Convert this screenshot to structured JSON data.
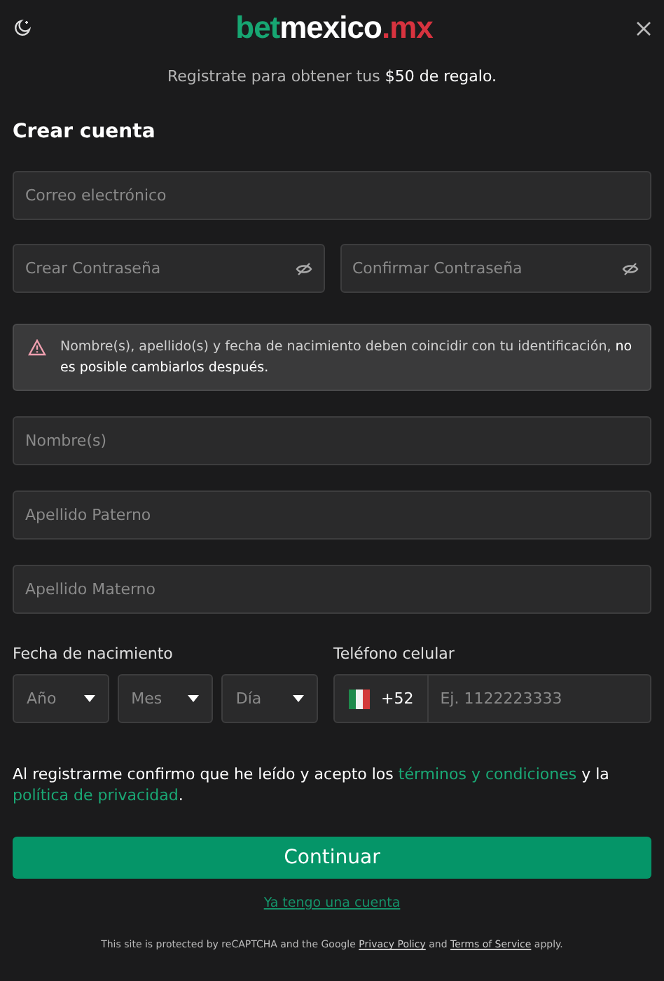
{
  "header": {
    "logo": [
      {
        "text": "bet",
        "color": "#17a672"
      },
      {
        "text": "mexico",
        "color": "#ffffff"
      },
      {
        "text": ".mx",
        "color": "#d8333f"
      }
    ]
  },
  "promo": "Registrate para obtener tus **$50 de regalo.**",
  "title": "Crear cuenta",
  "email": {
    "placeholder": "Correo electrónico"
  },
  "passwords": [
    {
      "placeholder": "Crear Contraseña"
    },
    {
      "placeholder": "Confirmar Contraseña"
    }
  ],
  "notice": "Nombre(s), apellido(s) y fecha de nacimiento deben coincidir con tu identificación, **no es posible cambiarlos después.**",
  "name_fields": [
    {
      "placeholder": "Nombre(s)"
    },
    {
      "placeholder": "Apellido Paterno"
    },
    {
      "placeholder": "Apellido Materno"
    }
  ],
  "birth_date": {
    "label": "Fecha de nacimiento",
    "selects": [
      {
        "placeholder": "Año"
      },
      {
        "placeholder": "Mes"
      },
      {
        "placeholder": "Día"
      }
    ]
  },
  "phone": {
    "label": "Teléfono celular",
    "prefix": "+52",
    "placeholder": "Ej. 1122223333"
  },
  "consent": [
    {
      "kind": "text",
      "text": "Al registrarme confirmo que he leído y acepto los "
    },
    {
      "kind": "link",
      "text": "términos y condiciones"
    },
    {
      "kind": "text",
      "text": " y la "
    },
    {
      "kind": "link",
      "text": "política de privacidad"
    },
    {
      "kind": "text",
      "text": "."
    }
  ],
  "continue_button": "Continuar",
  "login_link": "Ya tengo una cuenta",
  "recaptcha": [
    {
      "kind": "text",
      "text": "This site is protected by reCAPTCHA and the Google "
    },
    {
      "kind": "link",
      "text": "Privacy Policy"
    },
    {
      "kind": "text",
      "text": " and "
    },
    {
      "kind": "link",
      "text": "Terms of Service"
    },
    {
      "kind": "text",
      "text": " apply."
    }
  ]
}
